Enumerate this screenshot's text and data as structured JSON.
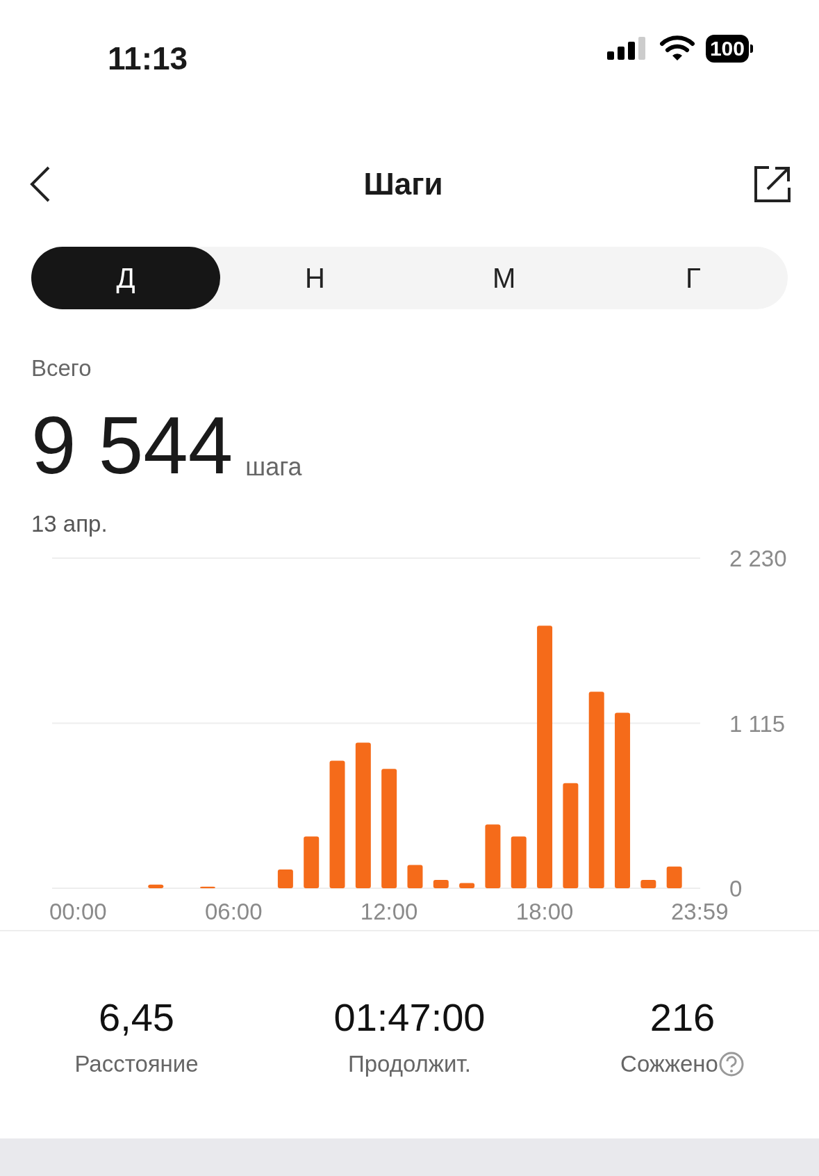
{
  "status_bar": {
    "time": "11:13",
    "battery": "100"
  },
  "header": {
    "title": "Шаги"
  },
  "tabs": [
    {
      "label": "Д",
      "selected": true
    },
    {
      "label": "Н",
      "selected": false
    },
    {
      "label": "М",
      "selected": false
    },
    {
      "label": "Г",
      "selected": false
    }
  ],
  "summary": {
    "label": "Всего",
    "value": "9 544",
    "unit": "шага",
    "date": "13 апр."
  },
  "chart_data": {
    "type": "bar",
    "x": [
      0,
      1,
      2,
      3,
      4,
      5,
      6,
      7,
      8,
      9,
      10,
      11,
      12,
      13,
      14,
      15,
      16,
      17,
      18,
      19,
      20,
      21,
      22,
      23
    ],
    "series": [
      {
        "color": "#f56b1a",
        "values": [
          0,
          0,
          0,
          25,
          0,
          10,
          0,
          0,
          127,
          350,
          862,
          983,
          806,
          157,
          56,
          35,
          431,
          350,
          1774,
          710,
          1328,
          1186,
          56,
          147
        ]
      }
    ],
    "xlim": [
      -1,
      24
    ],
    "ylim": [
      0,
      2230
    ],
    "yticks": [
      {
        "value": 0,
        "label": "0"
      },
      {
        "value": 1115,
        "label": "1 115"
      },
      {
        "value": 2230,
        "label": "2 230"
      }
    ],
    "xticks": [
      {
        "value": 0,
        "label": "00:00"
      },
      {
        "value": 6,
        "label": "06:00"
      },
      {
        "value": 12,
        "label": "12:00"
      },
      {
        "value": 18,
        "label": "18:00"
      },
      {
        "value": 23.98,
        "label": "23:59"
      }
    ]
  },
  "stats": [
    {
      "value": "6,45",
      "label": "Расстояние",
      "help": false
    },
    {
      "value": "01:47:00",
      "label": "Продолжит.",
      "help": false
    },
    {
      "value": "216",
      "label": "Сожжено",
      "help": true
    }
  ]
}
